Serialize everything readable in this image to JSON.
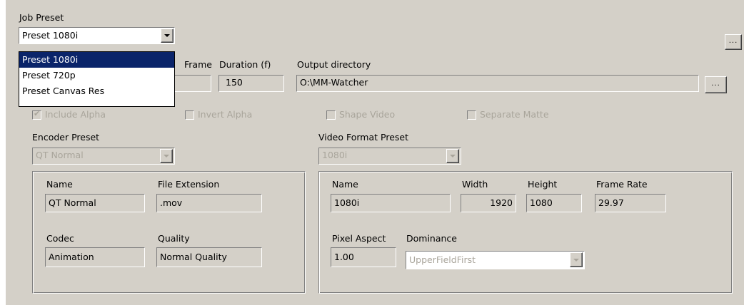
{
  "job_preset": {
    "label": "Job Preset",
    "selected": "Preset 1080i",
    "options": [
      "Preset 1080i",
      "Preset 720p",
      "Preset Canvas Res"
    ],
    "highlighted_index": 0,
    "browse_label": "..."
  },
  "fields": {
    "frame_label": "Frame",
    "duration_label": "Duration (f)",
    "duration_value": "150",
    "output_dir_label": "Output directory",
    "output_dir_value": "O:\\MM-Watcher",
    "output_browse_label": "..."
  },
  "checkboxes": [
    {
      "label": "Include Alpha",
      "checked": true
    },
    {
      "label": "Invert Alpha",
      "checked": false
    },
    {
      "label": "Shape Video",
      "checked": false
    },
    {
      "label": "Separate Matte",
      "checked": false
    }
  ],
  "encoder": {
    "label": "Encoder Preset",
    "selected": "QT Normal",
    "name_label": "Name",
    "name_value": "QT Normal",
    "ext_label": "File Extension",
    "ext_value": ".mov",
    "codec_label": "Codec",
    "codec_value": "Animation",
    "quality_label": "Quality",
    "quality_value": "Normal Quality"
  },
  "video_format": {
    "label": "Video Format Preset",
    "selected": "1080i",
    "name_label": "Name",
    "name_value": "1080i",
    "width_label": "Width",
    "width_value": "1920",
    "height_label": "Height",
    "height_value": "1080",
    "framerate_label": "Frame Rate",
    "framerate_value": "29.97",
    "pixel_aspect_label": "Pixel Aspect",
    "pixel_aspect_value": "1.00",
    "dominance_label": "Dominance",
    "dominance_value": "UpperFieldFirst"
  }
}
